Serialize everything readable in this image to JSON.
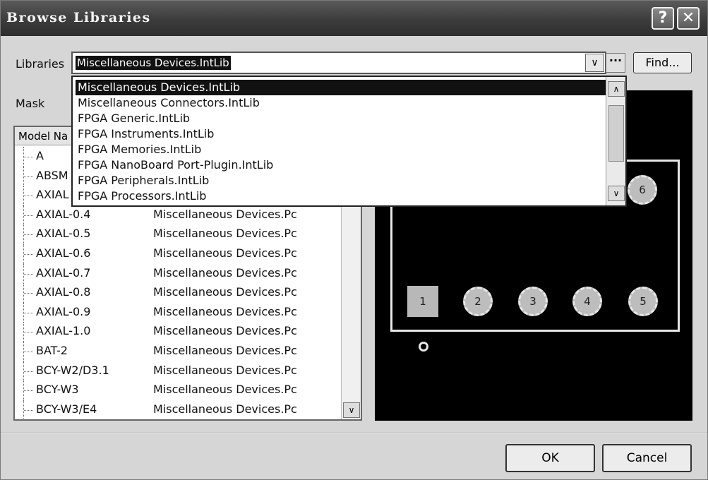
{
  "window": {
    "title": "Browse Libraries",
    "help_glyph": "?",
    "close_glyph": "✕"
  },
  "libraries": {
    "label": "Libraries",
    "selected": "Miscellaneous Devices.IntLib",
    "more_glyph": "···",
    "find_label": "Find..."
  },
  "dropdown": {
    "options": [
      "Miscellaneous Devices.IntLib",
      "Miscellaneous Connectors.IntLib",
      "FPGA Generic.IntLib",
      "FPGA Instruments.IntLib",
      "FPGA Memories.IntLib",
      "FPGA NanoBoard Port-Plugin.IntLib",
      "FPGA Peripherals.IntLib",
      "FPGA Processors.IntLib"
    ],
    "selected_index": 0
  },
  "mask": {
    "label": "Mask"
  },
  "grid": {
    "header_label": "Model Na",
    "rows": [
      {
        "name": "A",
        "library": ""
      },
      {
        "name": "ABSM",
        "library": ""
      },
      {
        "name": "AXIAL",
        "library": ""
      },
      {
        "name": "AXIAL-0.4",
        "library": "Miscellaneous Devices.Pc"
      },
      {
        "name": "AXIAL-0.5",
        "library": "Miscellaneous Devices.Pc"
      },
      {
        "name": "AXIAL-0.6",
        "library": "Miscellaneous Devices.Pc"
      },
      {
        "name": "AXIAL-0.7",
        "library": "Miscellaneous Devices.Pc"
      },
      {
        "name": "AXIAL-0.8",
        "library": "Miscellaneous Devices.Pc"
      },
      {
        "name": "AXIAL-0.9",
        "library": "Miscellaneous Devices.Pc"
      },
      {
        "name": "AXIAL-1.0",
        "library": "Miscellaneous Devices.Pc"
      },
      {
        "name": "BAT-2",
        "library": "Miscellaneous Devices.Pc"
      },
      {
        "name": "BCY-W2/D3.1",
        "library": "Miscellaneous Devices.Pc"
      },
      {
        "name": "BCY-W3",
        "library": "Miscellaneous Devices.Pc"
      },
      {
        "name": "BCY-W3/E4",
        "library": "Miscellaneous Devices.Pc"
      }
    ]
  },
  "preview": {
    "pads": [
      "1",
      "2",
      "3",
      "4",
      "5",
      "6"
    ]
  },
  "buttons": {
    "ok": "OK",
    "cancel": "Cancel"
  },
  "colors": {
    "titlebar": "#3c3c3c",
    "preview_bg": "#000000",
    "selection": "#111111"
  }
}
